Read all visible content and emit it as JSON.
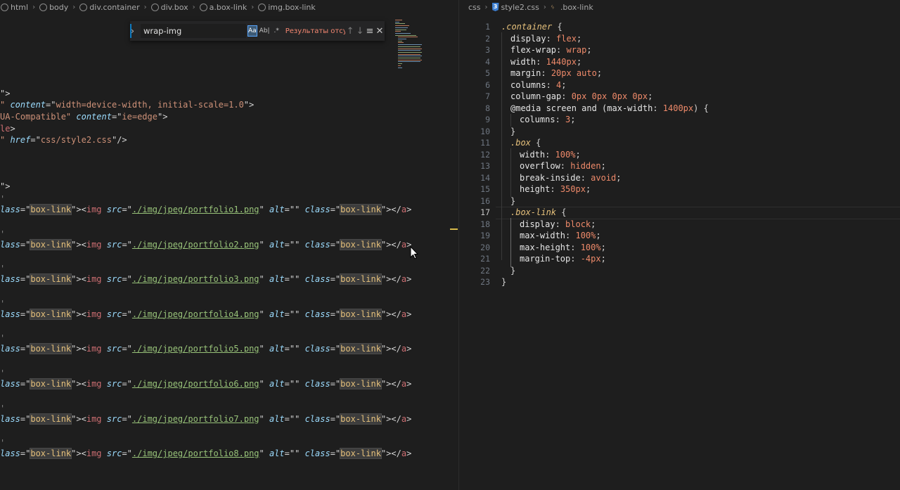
{
  "left_breadcrumb": [
    "html",
    "body",
    "div.container",
    "div.box",
    "a.box-link",
    "img.box-link"
  ],
  "right_breadcrumb": [
    "css",
    "style2.css",
    ".box-link"
  ],
  "find_widget": {
    "query": "wrap-img",
    "match_case": "Aa",
    "whole_word": "Ab|",
    "regex": ".*",
    "status": "Результаты отсутствуют"
  },
  "html_head_lines": [
    {
      "frag": [
        {
          "c": "t-pun",
          "t": "\">"
        }
      ]
    },
    {
      "frag": [
        {
          "c": "t-str",
          "t": "\" "
        },
        {
          "c": "t-attr",
          "t": "content"
        },
        {
          "c": "t-pun",
          "t": "=\""
        },
        {
          "c": "t-str",
          "t": "width=device-width, initial-scale=1.0"
        },
        {
          "c": "t-pun",
          "t": "\">"
        }
      ]
    },
    {
      "frag": [
        {
          "c": "t-str",
          "t": "UA-Compatible\" "
        },
        {
          "c": "t-attr",
          "t": "content"
        },
        {
          "c": "t-pun",
          "t": "=\""
        },
        {
          "c": "t-str",
          "t": "ie=edge"
        },
        {
          "c": "t-pun",
          "t": "\">"
        }
      ]
    },
    {
      "frag": [
        {
          "c": "t-tag",
          "t": "le"
        },
        {
          "c": "t-pun",
          "t": ">"
        }
      ]
    },
    {
      "frag": [
        {
          "c": "t-str",
          "t": "\" "
        },
        {
          "c": "t-attr",
          "t": "href"
        },
        {
          "c": "t-pun",
          "t": "=\""
        },
        {
          "c": "t-str",
          "t": "css/style2.css"
        },
        {
          "c": "t-pun",
          "t": "\"/>"
        }
      ]
    }
  ],
  "html_container_line": "\">",
  "portfolio_rows": [
    {
      "attr_class": "lass",
      "class_value": "box-link",
      "src": "./img/jpeg/portfolio1.png",
      "alt": ""
    },
    {
      "attr_class": "lass",
      "class_value": "box-link",
      "src": "./img/jpeg/portfolio2.png",
      "alt": ""
    },
    {
      "attr_class": "lass",
      "class_value": "box-link",
      "src": "./img/jpeg/portfolio3.png",
      "alt": ""
    },
    {
      "attr_class": "lass",
      "class_value": "box-link",
      "src": "./img/jpeg/portfolio4.png",
      "alt": ""
    },
    {
      "attr_class": "lass",
      "class_value": "box-link",
      "src": "./img/jpeg/portfolio5.png",
      "alt": ""
    },
    {
      "attr_class": "lass",
      "class_value": "box-link",
      "src": "./img/jpeg/portfolio6.png",
      "alt": ""
    },
    {
      "attr_class": "lass",
      "class_value": "box-link",
      "src": "./img/jpeg/portfolio7.png",
      "alt": ""
    },
    {
      "attr_class": "lass",
      "class_value": "box-link",
      "src": "./img/jpeg/portfolio8.png",
      "alt": ""
    }
  ],
  "css_lines": [
    {
      "n": "1",
      "indent": 0,
      "frag": [
        {
          "c": "sel",
          "t": ".container"
        },
        {
          "c": "brace",
          "t": " {"
        }
      ]
    },
    {
      "n": "2",
      "indent": 1,
      "frag": [
        {
          "c": "prop",
          "t": "display"
        },
        {
          "c": "brace",
          "t": ": "
        },
        {
          "c": "val",
          "t": "flex"
        },
        {
          "c": "brace",
          "t": ";"
        }
      ]
    },
    {
      "n": "3",
      "indent": 1,
      "frag": [
        {
          "c": "prop",
          "t": "flex-wrap"
        },
        {
          "c": "brace",
          "t": ": "
        },
        {
          "c": "val",
          "t": "wrap"
        },
        {
          "c": "brace",
          "t": ";"
        }
      ]
    },
    {
      "n": "4",
      "indent": 1,
      "frag": [
        {
          "c": "prop",
          "t": "width"
        },
        {
          "c": "brace",
          "t": ": "
        },
        {
          "c": "val",
          "t": "1440px"
        },
        {
          "c": "brace",
          "t": ";"
        }
      ]
    },
    {
      "n": "5",
      "indent": 1,
      "frag": [
        {
          "c": "prop",
          "t": "margin"
        },
        {
          "c": "brace",
          "t": ": "
        },
        {
          "c": "val",
          "t": "20px auto"
        },
        {
          "c": "brace",
          "t": ";"
        }
      ]
    },
    {
      "n": "6",
      "indent": 1,
      "frag": [
        {
          "c": "prop",
          "t": "columns"
        },
        {
          "c": "brace",
          "t": ": "
        },
        {
          "c": "val",
          "t": "4"
        },
        {
          "c": "brace",
          "t": ";"
        }
      ]
    },
    {
      "n": "7",
      "indent": 1,
      "frag": [
        {
          "c": "prop",
          "t": "column-gap"
        },
        {
          "c": "brace",
          "t": ": "
        },
        {
          "c": "val",
          "t": "0px 0px 0px 0px"
        },
        {
          "c": "brace",
          "t": ";"
        }
      ]
    },
    {
      "n": "8",
      "indent": 1,
      "frag": [
        {
          "c": "at",
          "t": "@media screen and ("
        },
        {
          "c": "prop",
          "t": "max-width"
        },
        {
          "c": "brace",
          "t": ": "
        },
        {
          "c": "val",
          "t": "1400px"
        },
        {
          "c": "brace",
          "t": ") {"
        }
      ]
    },
    {
      "n": "9",
      "indent": 2,
      "frag": [
        {
          "c": "prop",
          "t": "columns"
        },
        {
          "c": "brace",
          "t": ": "
        },
        {
          "c": "val",
          "t": "3"
        },
        {
          "c": "brace",
          "t": ";"
        }
      ]
    },
    {
      "n": "10",
      "indent": 1,
      "frag": [
        {
          "c": "brace",
          "t": "}"
        }
      ]
    },
    {
      "n": "11",
      "indent": 1,
      "frag": [
        {
          "c": "sel",
          "t": ".box"
        },
        {
          "c": "brace",
          "t": " {"
        }
      ]
    },
    {
      "n": "12",
      "indent": 2,
      "frag": [
        {
          "c": "prop",
          "t": "width"
        },
        {
          "c": "brace",
          "t": ": "
        },
        {
          "c": "val",
          "t": "100%"
        },
        {
          "c": "brace",
          "t": ";"
        }
      ]
    },
    {
      "n": "13",
      "indent": 2,
      "frag": [
        {
          "c": "prop",
          "t": "overflow"
        },
        {
          "c": "brace",
          "t": ": "
        },
        {
          "c": "val",
          "t": "hidden"
        },
        {
          "c": "brace",
          "t": ";"
        }
      ]
    },
    {
      "n": "14",
      "indent": 2,
      "frag": [
        {
          "c": "prop",
          "t": "break-inside"
        },
        {
          "c": "brace",
          "t": ": "
        },
        {
          "c": "val",
          "t": "avoid"
        },
        {
          "c": "brace",
          "t": ";"
        }
      ]
    },
    {
      "n": "15",
      "indent": 2,
      "frag": [
        {
          "c": "prop",
          "t": "height"
        },
        {
          "c": "brace",
          "t": ": "
        },
        {
          "c": "val",
          "t": "350px"
        },
        {
          "c": "brace",
          "t": ";"
        }
      ]
    },
    {
      "n": "16",
      "indent": 1,
      "frag": [
        {
          "c": "brace",
          "t": "}"
        }
      ]
    },
    {
      "n": "17",
      "indent": 1,
      "frag": [
        {
          "c": "sel",
          "t": ".box-link"
        },
        {
          "c": "brace",
          "t": " {"
        }
      ]
    },
    {
      "n": "18",
      "indent": 2,
      "frag": [
        {
          "c": "prop",
          "t": "display"
        },
        {
          "c": "brace",
          "t": ": "
        },
        {
          "c": "val",
          "t": "block"
        },
        {
          "c": "brace",
          "t": ";"
        }
      ]
    },
    {
      "n": "19",
      "indent": 2,
      "frag": [
        {
          "c": "prop",
          "t": "max-width"
        },
        {
          "c": "brace",
          "t": ": "
        },
        {
          "c": "val",
          "t": "100%"
        },
        {
          "c": "brace",
          "t": ";"
        }
      ]
    },
    {
      "n": "20",
      "indent": 2,
      "frag": [
        {
          "c": "prop",
          "t": "max-height"
        },
        {
          "c": "brace",
          "t": ": "
        },
        {
          "c": "val",
          "t": "100%"
        },
        {
          "c": "brace",
          "t": ";"
        }
      ]
    },
    {
      "n": "21",
      "indent": 2,
      "frag": [
        {
          "c": "prop",
          "t": "margin-top"
        },
        {
          "c": "brace",
          "t": ": "
        },
        {
          "c": "val",
          "t": "-4px"
        },
        {
          "c": "brace",
          "t": ";"
        }
      ]
    },
    {
      "n": "22",
      "indent": 1,
      "frag": [
        {
          "c": "brace",
          "t": "}"
        }
      ]
    },
    {
      "n": "23",
      "indent": 0,
      "frag": [
        {
          "c": "brace",
          "t": "}"
        }
      ]
    }
  ],
  "active_css_line": "17",
  "colors": {
    "find_status": "#f48771",
    "selector": "#e5c07b",
    "value": "#ef8a6a",
    "string": "#98c379",
    "attr": "#9cdcfe",
    "tag": "#cd6e72"
  }
}
